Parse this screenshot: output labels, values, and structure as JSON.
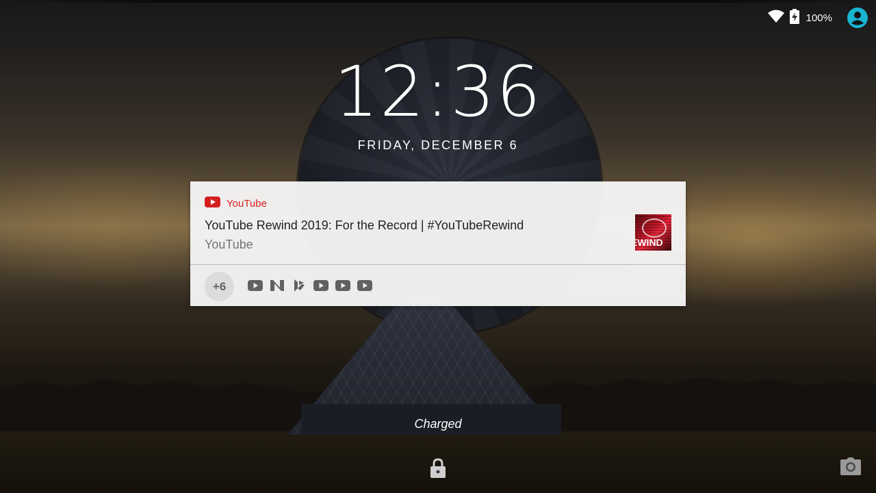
{
  "status_bar": {
    "battery_percent": "100%",
    "icons": [
      "wifi-icon",
      "battery-charging-icon",
      "account-icon"
    ],
    "accent_color": "#18b5d0"
  },
  "lockscreen": {
    "time": "12:36",
    "date": "FRIDAY, DECEMBER 6",
    "charging_status": "Charged"
  },
  "notification": {
    "app_name": "YouTube",
    "app_color": "#d3201f",
    "title": "YouTube Rewind 2019: For the Record | #YouTubeRewind",
    "text": "YouTube",
    "thumbnail_text": "EWIND",
    "more_count": "+6",
    "more_icons": [
      "youtube-icon",
      "news-icon",
      "play-store-icon",
      "youtube-icon",
      "youtube-icon",
      "youtube-icon"
    ]
  },
  "bottom": {
    "icons": [
      "lock-icon",
      "camera-icon"
    ]
  }
}
